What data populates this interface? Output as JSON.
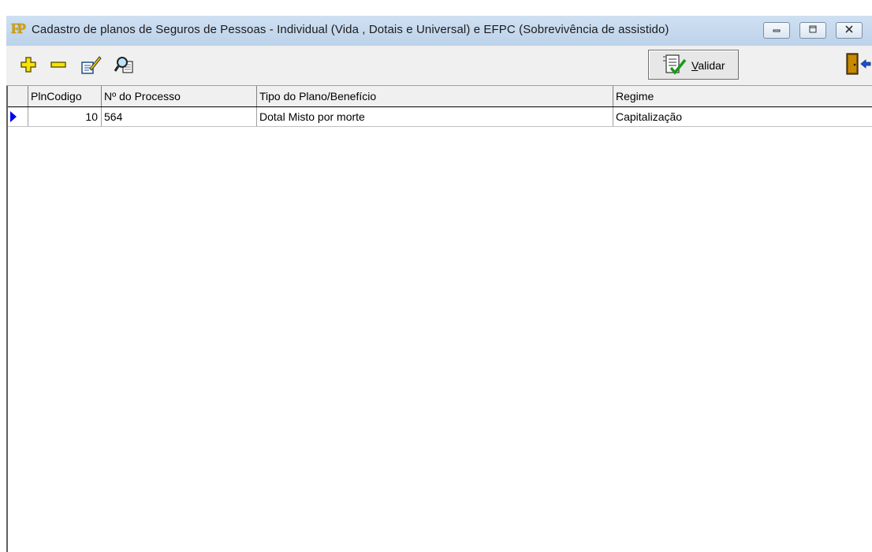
{
  "window": {
    "title": "Cadastro de planos de Seguros de Pessoas - Individual (Vida , Dotais e Universal) e EFPC (Sobrevivência de assistido)",
    "icon": "fp-app-icon"
  },
  "toolbar": {
    "buttons": [
      "add-icon",
      "remove-icon",
      "edit-icon",
      "search-icon"
    ],
    "validar_label": "Validar",
    "exit_icon": "exit-door-icon"
  },
  "grid": {
    "columns": [
      "PlnCodigo",
      "Nº do Processo",
      "Tipo do Plano/Benefício",
      "Regime"
    ],
    "rows": [
      {
        "codigo": "10",
        "processo": "564",
        "tipo": "Dotal Misto por morte",
        "regime": "Capitalização"
      }
    ]
  },
  "colors": {
    "titlebar": "#bcd2ea",
    "chrome": "#f0f0f0",
    "indicator": "#0000ee"
  }
}
